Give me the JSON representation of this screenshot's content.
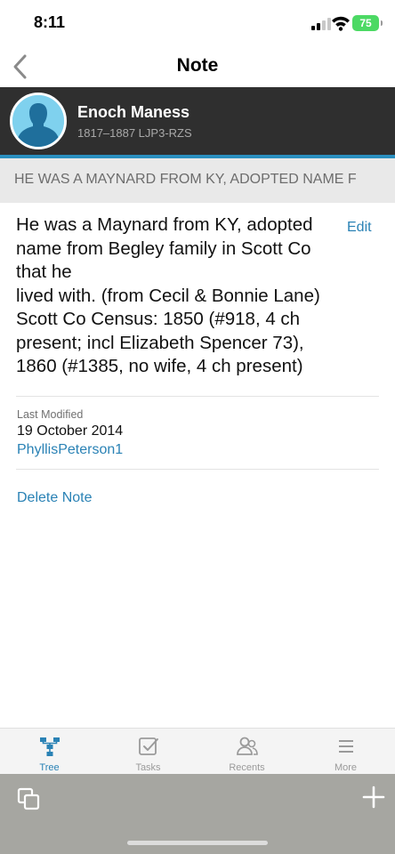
{
  "status_bar": {
    "time": "8:11",
    "battery": "75"
  },
  "nav": {
    "title": "Note",
    "back_icon": "chevron-left-icon"
  },
  "person": {
    "name": "Enoch Maness",
    "meta": "1817–1887  LJP3-RZS",
    "avatar_icon": "male-silhouette-icon",
    "accent_color": "#2a8fbf"
  },
  "note": {
    "title": "HE WAS A MAYNARD FROM KY, ADOPTED NAME F",
    "body": "He was a Maynard from KY, adopted name from Begley family in Scott Co that he\nlived with. (from Cecil & Bonnie Lane) Scott Co Census: 1850 (#918, 4 ch present; incl Elizabeth Spencer 73), 1860 (#1385, no wife, 4 ch present)",
    "edit_label": "Edit",
    "last_modified_label": "Last Modified",
    "last_modified_date": "19 October 2014",
    "last_modified_user": "PhyllisPeterson1",
    "delete_label": "Delete Note"
  },
  "tabs": [
    {
      "label": "Tree",
      "icon": "tree-icon",
      "active": true
    },
    {
      "label": "Tasks",
      "icon": "tasks-icon",
      "active": false
    },
    {
      "label": "Recents",
      "icon": "recents-icon",
      "active": false
    },
    {
      "label": "More",
      "icon": "menu-icon",
      "active": false
    }
  ],
  "colors": {
    "link": "#2a82b5",
    "header_bg": "#2f2f2f",
    "strip_bg": "#e9e9e9",
    "toolbar_bg": "#a6a6a1"
  }
}
